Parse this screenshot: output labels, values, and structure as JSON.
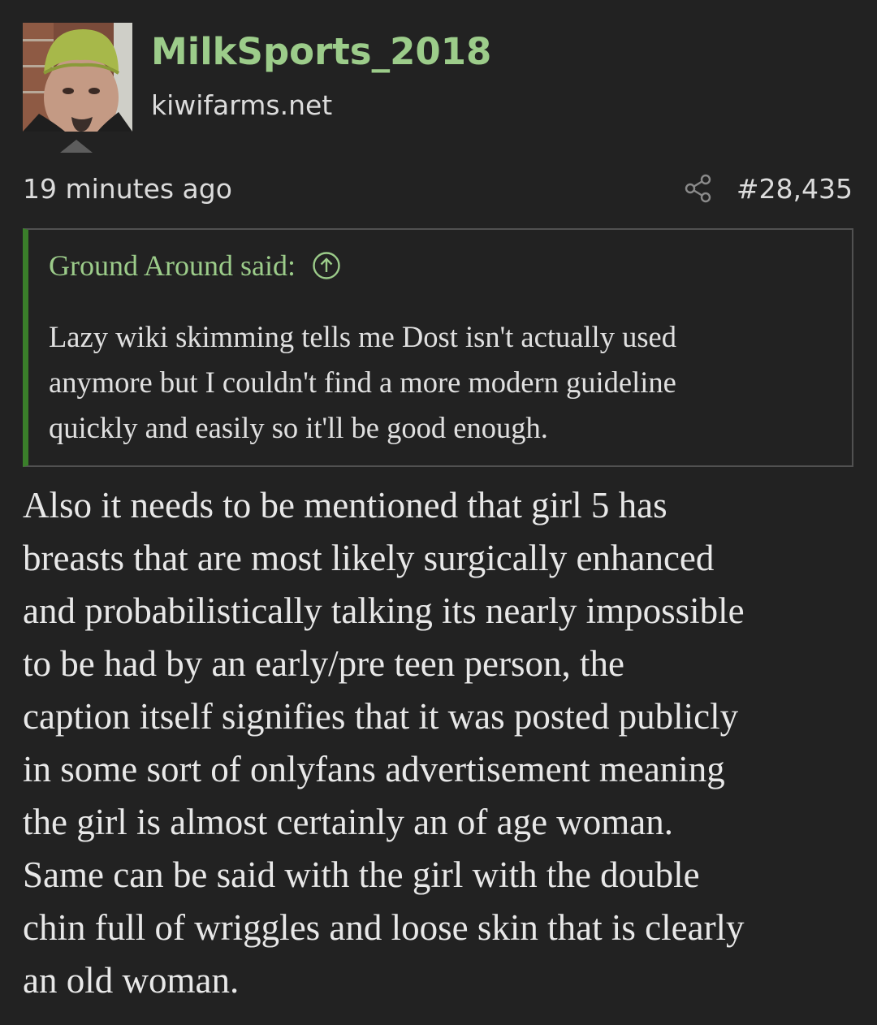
{
  "post": {
    "author": {
      "username": "MilkSports_2018",
      "site": "kiwifarms.net"
    },
    "timestamp": "19 minutes ago",
    "post_number": "#28,435",
    "colors": {
      "background": "#222222",
      "username": "#9ccc8a",
      "quote_border_accent": "#3a7f2a",
      "quote_border": "#515151"
    },
    "icons": [
      "share-icon",
      "arrow-up-circle-icon"
    ],
    "quote": {
      "attribution": "Ground Around said:",
      "lines": [
        "Lazy wiki skimming tells me Dost isn't actually used",
        "anymore but I couldn't find a more modern guideline",
        "quickly and easily so it'll be good enough."
      ]
    },
    "body_lines": [
      "Also it needs to be mentioned that girl 5 has",
      "breasts that are most likely surgically enhanced",
      "and probabilistically talking its nearly impossible",
      "to be had by an early/pre teen person, the",
      "caption itself signifies that it was posted publicly",
      "in some sort of onlyfans advertisement meaning",
      "the girl is almost certainly an of age woman.",
      "Same can be said with the girl with the double",
      "chin full of wriggles and loose skin that is clearly",
      "an old woman."
    ]
  }
}
